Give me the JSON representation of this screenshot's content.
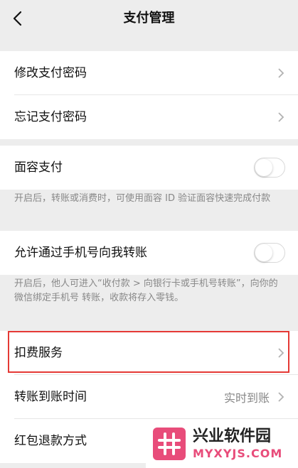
{
  "header": {
    "title": "支付管理"
  },
  "section_password": {
    "items": [
      {
        "label": "修改支付密码"
      },
      {
        "label": "忘记支付密码"
      }
    ]
  },
  "face_pay": {
    "label": "面容支付",
    "enabled": false,
    "note": "开启后，转账或消费时，可使用面容 ID 验证面容快速完成付款"
  },
  "phone_transfer": {
    "label": "允许通过手机号向我转账",
    "enabled": false,
    "note": "开启后，他人可进入“收付款 > 向银行卡或手机号转账”，向你的微信绑定手机号                         转账，收款将存入零钱。"
  },
  "services": {
    "deduction": {
      "label": "扣费服务"
    },
    "transfer_time": {
      "label": "转账到账时间",
      "value": "实时到账"
    },
    "red_packet_refund": {
      "label": "红包退款方式"
    }
  },
  "watermark": {
    "title": "兴业软件园",
    "url": "MYXYJS.COM"
  },
  "colors": {
    "highlight": "#e53935",
    "watermark_brand": "#e84c7a"
  }
}
